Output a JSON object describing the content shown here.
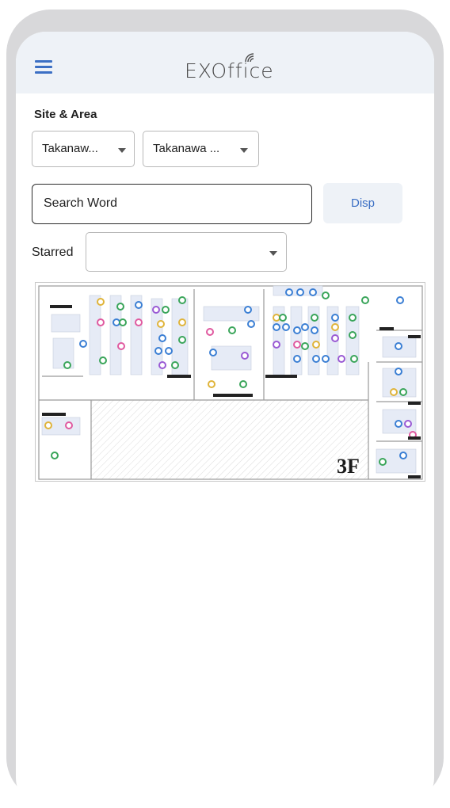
{
  "app": {
    "logo_text": "EXOffice"
  },
  "filters": {
    "section_label": "Site & Area",
    "site_select": {
      "value": "Takanaw..."
    },
    "area_select": {
      "value": "Takanawa ..."
    }
  },
  "search": {
    "placeholder": "Search Word",
    "value": "",
    "button_label": "Disp"
  },
  "starred": {
    "label": "Starred",
    "value": ""
  },
  "floor_map": {
    "floor_label": "3F"
  },
  "colors": {
    "accent": "#3b6fc4",
    "appbar_bg": "#eef2f7",
    "button_bg": "#eef2f7"
  }
}
